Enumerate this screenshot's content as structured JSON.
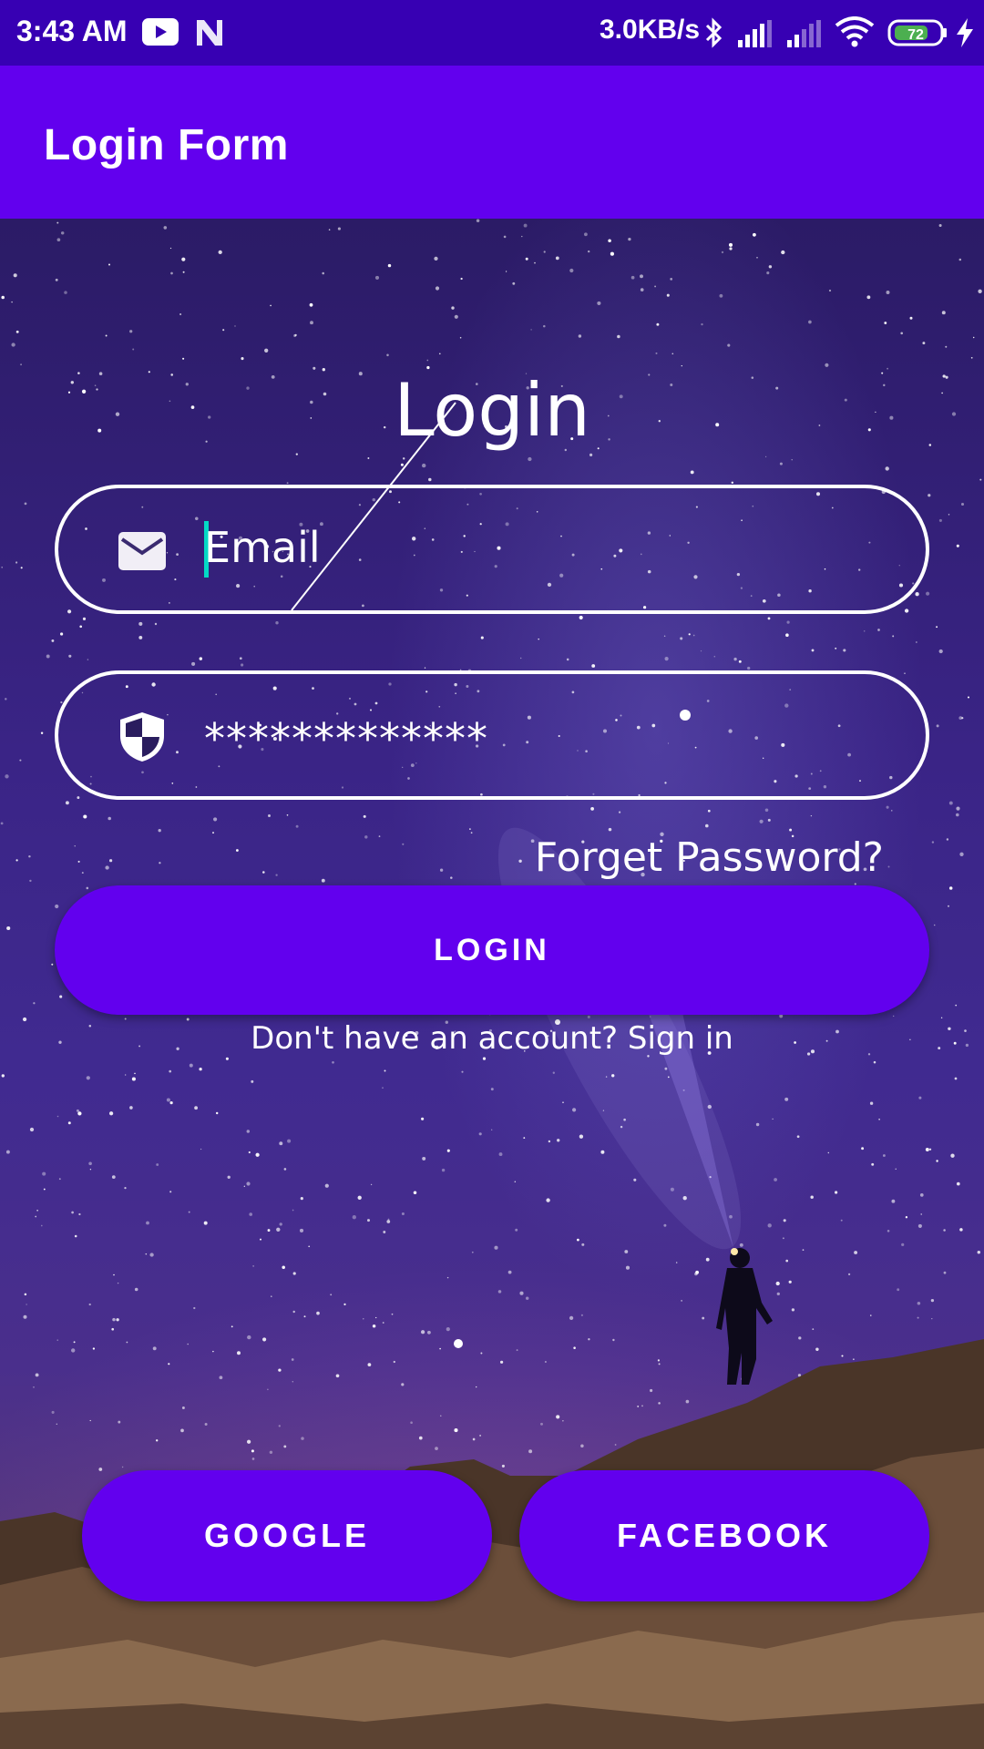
{
  "status_bar": {
    "time": "3:43 AM",
    "network_speed": "3.0KB/s",
    "battery_level": "72",
    "icons": [
      "youtube-icon",
      "n-icon",
      "bluetooth-icon",
      "signal-icon",
      "signal-icon",
      "wifi-icon",
      "battery-icon",
      "charging-icon"
    ]
  },
  "app_bar": {
    "title": "Login Form"
  },
  "form": {
    "heading": "Login",
    "email": {
      "placeholder": "Email",
      "icon": "mail-icon"
    },
    "password": {
      "value": "*************",
      "icon": "shield-icon"
    },
    "forgot_link": "Forget Password?",
    "login_button": "LOGIN",
    "signup_prompt": "Don't have an account? Sign in"
  },
  "social": {
    "google_button": "GOOGLE",
    "facebook_button": "FACEBOOK"
  },
  "colors": {
    "status_bar": "#3700b3",
    "primary": "#6200ee",
    "cursor": "#03dac5"
  }
}
